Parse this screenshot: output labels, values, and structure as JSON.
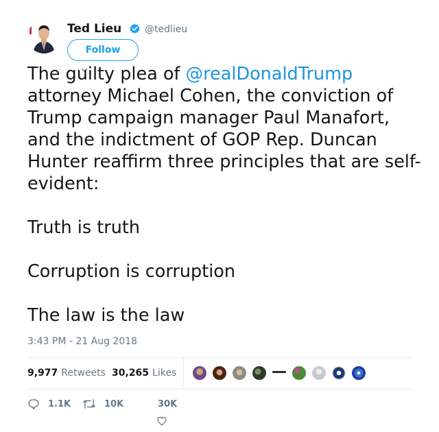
{
  "author": {
    "name": "Ted Lieu",
    "handle": "@tedlieu",
    "verified": true,
    "follow_label": "Follow"
  },
  "tweet": {
    "text_before": "The guilty plea of ",
    "mention": "@realDonaldTrump",
    "text_after": " attorney Michael Cohen, the conviction of Trump campaign manager Paul Manafort, and the indictment of GOP Rep. Duncan Hunter reaffirm three principles that are self-evident:\n\nTruth is truth\n\nCorruption is corruption\n\nThe law is the law",
    "timestamp": "3:43 PM - 21 Aug 2018"
  },
  "stats": {
    "retweets_count": "9,977",
    "retweets_label": "Retweets",
    "likes_count": "30,265",
    "likes_label": "Likes"
  },
  "actions": {
    "replies": "1.1K",
    "retweets": "10K",
    "likes": "30K"
  },
  "colors": {
    "accent": "#1da1f2",
    "link": "#1b95e0",
    "muted": "#657786",
    "text": "#14171a"
  },
  "icons": [
    "verified-badge-icon",
    "chevron-down-icon",
    "reply-icon",
    "retweet-icon",
    "heart-icon"
  ]
}
